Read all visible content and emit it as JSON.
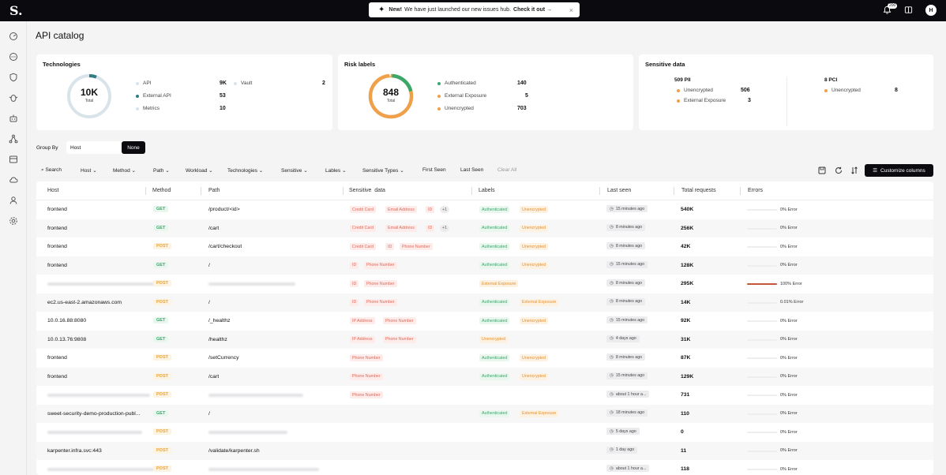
{
  "topbar": {
    "logo": "S.",
    "banner_new": "New!",
    "banner_text": "We have just launched our new issues hub.",
    "banner_link": "Check it out →",
    "banner_close": "×",
    "notification_count": "200",
    "avatar_initial": "H"
  },
  "sidebar": {
    "icons": [
      "dashboard-icon",
      "chat-icon",
      "shield-icon",
      "bug-icon",
      "robot-icon",
      "graph-icon",
      "inventory-icon",
      "cloud-icon",
      "identity-icon",
      "settings-icon"
    ]
  },
  "page": {
    "title": "API catalog"
  },
  "technologies": {
    "title": "Technologies",
    "total_value": "10K",
    "total_label": "Total",
    "items": [
      {
        "label": "API",
        "value": "9K",
        "color": "#d9e3ea"
      },
      {
        "label": "External API",
        "value": "53",
        "color": "#2f7d82"
      },
      {
        "label": "Metrics",
        "value": "10",
        "color": "#d9e3ea"
      },
      {
        "label": "Vault",
        "value": "2",
        "color": "#d9e3ea"
      }
    ]
  },
  "risk_labels": {
    "title": "Risk labels",
    "total_value": "848",
    "total_label": "Total",
    "items": [
      {
        "label": "Authenticated",
        "value": "140",
        "color": "#3aa86b"
      },
      {
        "label": "External Exposure",
        "value": "5",
        "color": "#f0a04b"
      },
      {
        "label": "Unencrypted",
        "value": "703",
        "color": "#f0a04b"
      }
    ]
  },
  "sensitive": {
    "title": "Sensitive data",
    "pii": {
      "header": "509 PII",
      "items": [
        {
          "label": "Unencrypted",
          "value": "506"
        },
        {
          "label": "External Exposure",
          "value": "3"
        }
      ]
    },
    "pci": {
      "header": "8 PCI",
      "items": [
        {
          "label": "Unencrypted",
          "value": "8"
        }
      ]
    }
  },
  "groupby": {
    "label": "Group By",
    "value": "Host",
    "button": "None"
  },
  "filters": {
    "search": "Search",
    "host": "Host",
    "method": "Method",
    "path": "Path",
    "workload": "Workload",
    "technologies": "Technologies",
    "sensitive": "Sensitive",
    "lables": "Lables",
    "sensitive_types": "Sensitive Types",
    "first_seen": "First Seen",
    "last_seen": "Last Seen",
    "clear_all": "Clear All",
    "customize": "Customize columns"
  },
  "table": {
    "headers": {
      "host": "Host",
      "method": "Method",
      "path": "Path",
      "sensitive": "Sensitive  data",
      "labels": "Labels",
      "last_seen": "Last seen",
      "total_requests": "Total requests",
      "errors": "Errors"
    },
    "rows": [
      {
        "host": "frontend",
        "method": "GET",
        "path": "/product/<id>",
        "sensitive": [
          "Credit Card",
          "Email Address",
          "ID"
        ],
        "more": "+1",
        "labels": [
          "Authenticated",
          "Unencrypted"
        ],
        "seen": "15 minutes ago",
        "requests": "540K",
        "error_pct": 0,
        "error_text": "0% Error"
      },
      {
        "host": "frontend",
        "method": "GET",
        "path": "/cart",
        "sensitive": [
          "Credit Card",
          "Email Address",
          "ID"
        ],
        "more": "+1",
        "labels": [
          "Authenticated",
          "Unencrypted"
        ],
        "seen": "8 minutes ago",
        "requests": "256K",
        "error_pct": 0,
        "error_text": "0% Error"
      },
      {
        "host": "frontend",
        "method": "POST",
        "path": "/cart/checkout",
        "sensitive": [
          "Credit Card",
          "ID",
          "Phone Number"
        ],
        "more": "",
        "labels": [
          "Authenticated",
          "Unencrypted"
        ],
        "seen": "8 minutes ago",
        "requests": "42K",
        "error_pct": 0,
        "error_text": "0% Error"
      },
      {
        "host": "frontend",
        "method": "GET",
        "path": "/",
        "sensitive": [
          "ID",
          "Phone Number"
        ],
        "more": "",
        "labels": [
          "Authenticated",
          "Unencrypted"
        ],
        "seen": "15 minutes ago",
        "requests": "128K",
        "error_pct": 0,
        "error_text": "0% Error"
      },
      {
        "host": "",
        "method": "POST",
        "path": "",
        "sensitive": [
          "ID",
          "Phone Number"
        ],
        "more": "",
        "labels": [
          "External Exposure"
        ],
        "seen": "8 minutes ago",
        "requests": "295K",
        "error_pct": 100,
        "error_text": "100% Error"
      },
      {
        "host": "ec2.us-east-2.amazonaws.com",
        "method": "POST",
        "path": "/",
        "sensitive": [
          "ID",
          "Phone Number"
        ],
        "more": "",
        "labels": [
          "Authenticated",
          "External Exposure"
        ],
        "seen": "8 minutes ago",
        "requests": "14K",
        "error_pct": 0,
        "error_text": "0.01% Error"
      },
      {
        "host": "10.0.16.88:8080",
        "method": "GET",
        "path": "/_healthz",
        "sensitive": [
          "IP Address",
          "Phone Number"
        ],
        "more": "",
        "labels": [
          "Authenticated",
          "Unencrypted"
        ],
        "seen": "15 minutes ago",
        "requests": "92K",
        "error_pct": 0,
        "error_text": "0% Error"
      },
      {
        "host": "10.0.13.76:9808",
        "method": "GET",
        "path": "/healthz",
        "sensitive": [
          "IP Address",
          "Phone Number"
        ],
        "more": "",
        "labels": [
          "Unencrypted"
        ],
        "seen": "4 days ago",
        "requests": "31K",
        "error_pct": 0,
        "error_text": "0% Error"
      },
      {
        "host": "frontend",
        "method": "POST",
        "path": "/setCurrency",
        "sensitive": [
          "Phone Number"
        ],
        "more": "",
        "labels": [
          "Authenticated",
          "Unencrypted"
        ],
        "seen": "8 minutes ago",
        "requests": "87K",
        "error_pct": 0,
        "error_text": "0% Error"
      },
      {
        "host": "frontend",
        "method": "POST",
        "path": "/cart",
        "sensitive": [
          "Phone Number"
        ],
        "more": "",
        "labels": [
          "Authenticated",
          "Unencrypted"
        ],
        "seen": "15 minutes ago",
        "requests": "129K",
        "error_pct": 0,
        "error_text": "0% Error"
      },
      {
        "host": "",
        "method": "POST",
        "path": "",
        "sensitive": [
          "Phone Number"
        ],
        "more": "",
        "labels": [],
        "seen": "about 1 hour a...",
        "requests": "731",
        "error_pct": 0,
        "error_text": "0% Error"
      },
      {
        "host": "sweet-security-demo-production-publ...",
        "method": "GET",
        "path": "/",
        "sensitive": [],
        "more": "",
        "labels": [
          "Authenticated",
          "External Exposure"
        ],
        "seen": "18 minutes ago",
        "requests": "110",
        "error_pct": 0,
        "error_text": "0% Error"
      },
      {
        "host": "",
        "method": "POST",
        "path": "",
        "sensitive": [],
        "more": "",
        "labels": [],
        "seen": "5 days ago",
        "requests": "0",
        "error_pct": 0,
        "error_text": "0% Error"
      },
      {
        "host": "karpenter.infra.svc:443",
        "method": "POST",
        "path": "/validate/karpenter.sh",
        "sensitive": [],
        "more": "",
        "labels": [],
        "seen": "1 day ago",
        "requests": "11",
        "error_pct": 0,
        "error_text": "0% Error"
      },
      {
        "host": "",
        "method": "POST",
        "path": "",
        "sensitive": [],
        "more": "",
        "labels": [],
        "seen": "about 1 hour a...",
        "requests": "118",
        "error_pct": 0,
        "error_text": "0% Error"
      }
    ]
  }
}
